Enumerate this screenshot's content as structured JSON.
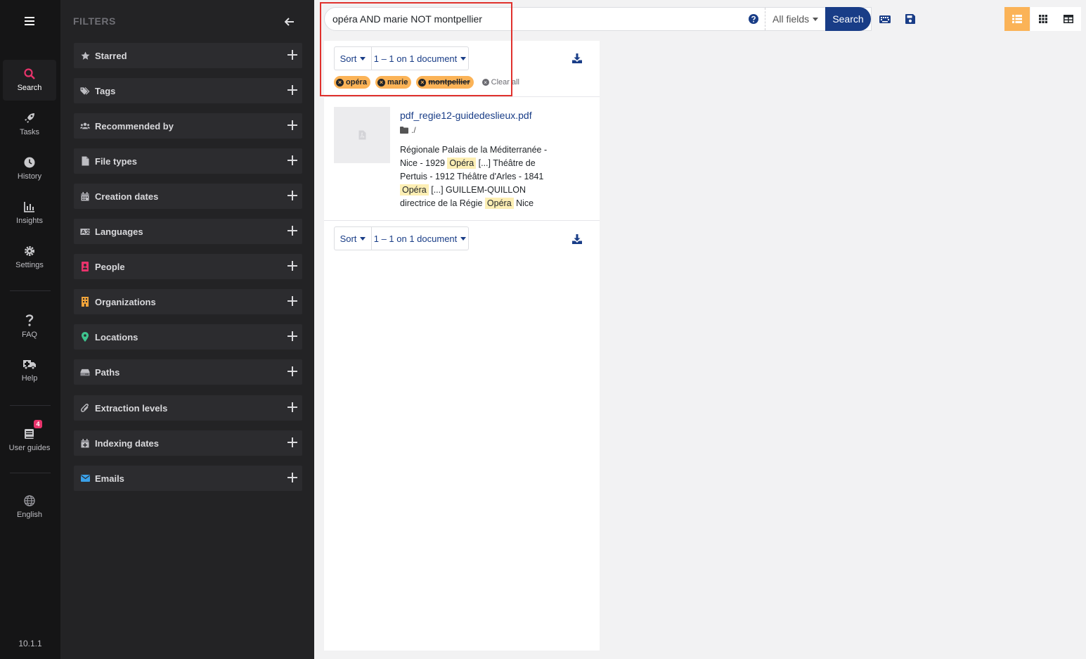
{
  "nav": {
    "items": [
      {
        "label": "Search",
        "icon": "search-icon"
      },
      {
        "label": "Tasks",
        "icon": "rocket-icon"
      },
      {
        "label": "History",
        "icon": "clock-icon"
      },
      {
        "label": "Insights",
        "icon": "chart-icon"
      },
      {
        "label": "Settings",
        "icon": "gear-icon"
      },
      {
        "label": "FAQ",
        "icon": "question-icon"
      },
      {
        "label": "Help",
        "icon": "ambulance-icon"
      },
      {
        "label": "User guides",
        "icon": "book-icon",
        "badge": "4"
      },
      {
        "label": "English",
        "icon": "globe-icon"
      }
    ],
    "version": "10.1.1"
  },
  "filters": {
    "title": "FILTERS",
    "items": [
      {
        "label": "Starred",
        "icon": "star-icon"
      },
      {
        "label": "Tags",
        "icon": "tags-icon"
      },
      {
        "label": "Recommended by",
        "icon": "users-icon"
      },
      {
        "label": "File types",
        "icon": "file-icon"
      },
      {
        "label": "Creation dates",
        "icon": "calendar-icon"
      },
      {
        "label": "Languages",
        "icon": "language-icon"
      },
      {
        "label": "People",
        "icon": "person-card-icon",
        "color": "#e8336b"
      },
      {
        "label": "Organizations",
        "icon": "building-icon",
        "color": "#f0a33a"
      },
      {
        "label": "Locations",
        "icon": "map-pin-icon",
        "color": "#3ec58f"
      },
      {
        "label": "Paths",
        "icon": "hdd-icon"
      },
      {
        "label": "Extraction levels",
        "icon": "paperclip-icon"
      },
      {
        "label": "Indexing dates",
        "icon": "calendar-plus-icon"
      },
      {
        "label": "Emails",
        "icon": "envelope-icon",
        "color": "#3aa0e8"
      }
    ]
  },
  "search": {
    "query": "opéra AND marie NOT montpellier",
    "field": "All fields",
    "button": "Search"
  },
  "results": {
    "sort_label": "Sort",
    "range_label": "1 – 1 on 1 document",
    "chips": [
      {
        "label": "opéra",
        "negated": false
      },
      {
        "label": "marie",
        "negated": false
      },
      {
        "label": "montpellier",
        "negated": true
      }
    ],
    "clear_all": "Clear all",
    "documents": [
      {
        "title": "pdf_regie12-guidedeslieux.pdf",
        "path": "./",
        "snippet": [
          {
            "t": "Régionale Palais de la Méditerranée - Nice - 1929 "
          },
          {
            "t": "Opéra",
            "hl": true
          },
          {
            "t": " [...] Théâtre de Pertuis - 1912 Théâtre d'Arles - 1841 "
          },
          {
            "t": "Opéra",
            "hl": true
          },
          {
            "t": " [...] GUILLEM-QUILLON directrice de la Régie "
          },
          {
            "t": "Opéra",
            "hl": true
          },
          {
            "t": " Nice"
          }
        ]
      }
    ]
  },
  "colors": {
    "accent": "#fbb357",
    "primary": "#193d87",
    "highlight_box": "#e0312d"
  }
}
